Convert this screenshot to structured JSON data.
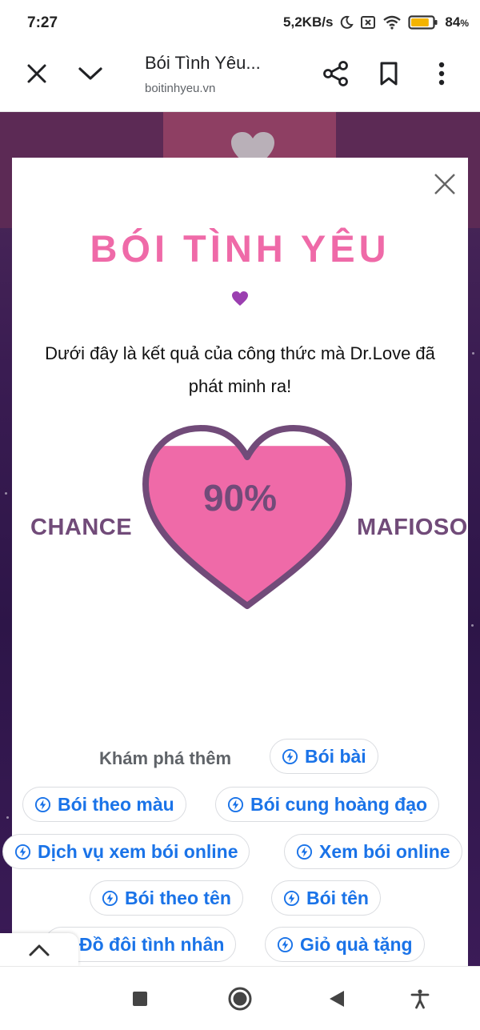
{
  "status": {
    "time": "7:27",
    "network_speed": "5,2KB/s",
    "battery_percent": "84",
    "battery_unit": "%",
    "battery_level": 0.84,
    "icons": [
      "moon-icon",
      "sim-off-icon",
      "wifi-icon",
      "battery-icon"
    ]
  },
  "browser": {
    "page_title": "Bói Tình Yêu...",
    "url": "boitinhyeu.vn",
    "icons": [
      "close-icon",
      "chevron-down-icon",
      "share-icon",
      "bookmark-icon",
      "more-vert-icon"
    ]
  },
  "modal": {
    "title": "BÓI TÌNH YÊU",
    "description": "Dưới đây là kết quả của công thức mà Dr.Love đã phát minh ra!",
    "result": {
      "percent": "90%",
      "fill_level": 0.9,
      "name_left": "CHANCE",
      "name_right": "MAFIOSO"
    },
    "explore_label": "Khám phá thêm",
    "chips": [
      {
        "label": "Bói bài"
      },
      {
        "label": "Bói theo màu"
      },
      {
        "label": "Bói cung hoàng đạo"
      },
      {
        "label": "Dịch vụ xem bói online"
      },
      {
        "label": "Xem bói online"
      },
      {
        "label": "Bói theo tên"
      },
      {
        "label": "Bói tên"
      },
      {
        "label": "Đồ đôi tình nhân"
      },
      {
        "label": "Giỏ quà tặng"
      }
    ]
  },
  "colors": {
    "title_pink": "#ef6aa8",
    "heart_fill": "#ef6aa8",
    "heart_border": "#714b79",
    "text_purple": "#714b79",
    "chip_blue": "#1a73e8",
    "background_purple": "#3a1c52"
  },
  "navigation": {
    "icons": [
      "recents-square-icon",
      "home-circle-icon",
      "back-triangle-icon",
      "accessibility-icon"
    ]
  }
}
